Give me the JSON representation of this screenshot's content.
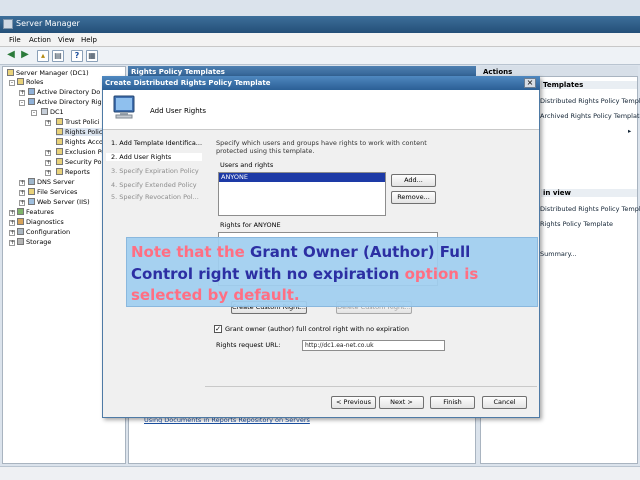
{
  "server_manager": {
    "title": "Server Manager",
    "menu": [
      "File",
      "Action",
      "View",
      "Help"
    ],
    "tree": [
      {
        "label": "Server Manager (DC1)",
        "level": 0
      },
      {
        "label": "Roles",
        "level": 1
      },
      {
        "label": "Active Directory Do",
        "level": 2
      },
      {
        "label": "Active Directory Rig",
        "level": 2
      },
      {
        "label": "DC1",
        "level": 3
      },
      {
        "label": "Trust Polici",
        "level": 4
      },
      {
        "label": "Rights Polic",
        "level": 4
      },
      {
        "label": "Rights Acco",
        "level": 4
      },
      {
        "label": "Exclusion Po",
        "level": 4
      },
      {
        "label": "Security Pol",
        "level": 4
      },
      {
        "label": "Reports",
        "level": 4
      },
      {
        "label": "DNS Server",
        "level": 2
      },
      {
        "label": "File Services",
        "level": 2
      },
      {
        "label": "Web Server (IIS)",
        "level": 2
      },
      {
        "label": "Features",
        "level": 1
      },
      {
        "label": "Diagnostics",
        "level": 1
      },
      {
        "label": "Configuration",
        "level": 1
      },
      {
        "label": "Storage",
        "level": 1
      }
    ],
    "center_header": "Rights Policy Templates",
    "center_link": "Using Documents in Reports Repository on Servers",
    "actions_header": "Actions",
    "actions": {
      "section1": "Templates",
      "items1": [
        "Distributed Rights Policy Templ...",
        "Archived Rights Policy Templates"
      ],
      "section2": "in view",
      "items2": [
        "Distributed Rights Policy Templ...",
        "Rights Policy Template",
        "Summary..."
      ]
    }
  },
  "wizard": {
    "title": "Create Distributed Rights Policy Template",
    "page_title": "Add User Rights",
    "steps": [
      {
        "label": "1. Add Template Identifica...",
        "state": "done"
      },
      {
        "label": "2. Add User Rights",
        "state": "active"
      },
      {
        "label": "3. Specify Expiration Policy",
        "state": "disabled"
      },
      {
        "label": "4. Specify Extended Policy",
        "state": "disabled"
      },
      {
        "label": "5. Specify Revocation Pol...",
        "state": "disabled"
      }
    ],
    "description": "Specify which users and groups have rights to work with content protected using this template.",
    "users_label": "Users and rights",
    "users": [
      "ANYONE"
    ],
    "add_button": "Add...",
    "remove_button": "Remove...",
    "rights_label": "Rights for ANYONE",
    "create_custom_right": "Create Custom Right...",
    "delete_custom_right": "Delete Custom Right...",
    "grant_owner_checked": true,
    "grant_owner_label": "Grant owner (author) full control right with no expiration",
    "rights_request_url_label": "Rights request URL:",
    "rights_request_url": "http://dc1.ea-net.co.uk",
    "buttons": {
      "previous": "< Previous",
      "next": "Next >",
      "finish": "Finish",
      "cancel": "Cancel"
    }
  },
  "callout": {
    "part1": "Note that the ",
    "part2": "Grant Owner (Author) Full Control right with no expiration",
    "part3": " option is selected by default."
  },
  "colors": {
    "callout_bg": "#a0cff0",
    "callout_pink": "#ff6f83",
    "callout_blue": "#2c2fa3",
    "selection": "#1d3aa6"
  }
}
